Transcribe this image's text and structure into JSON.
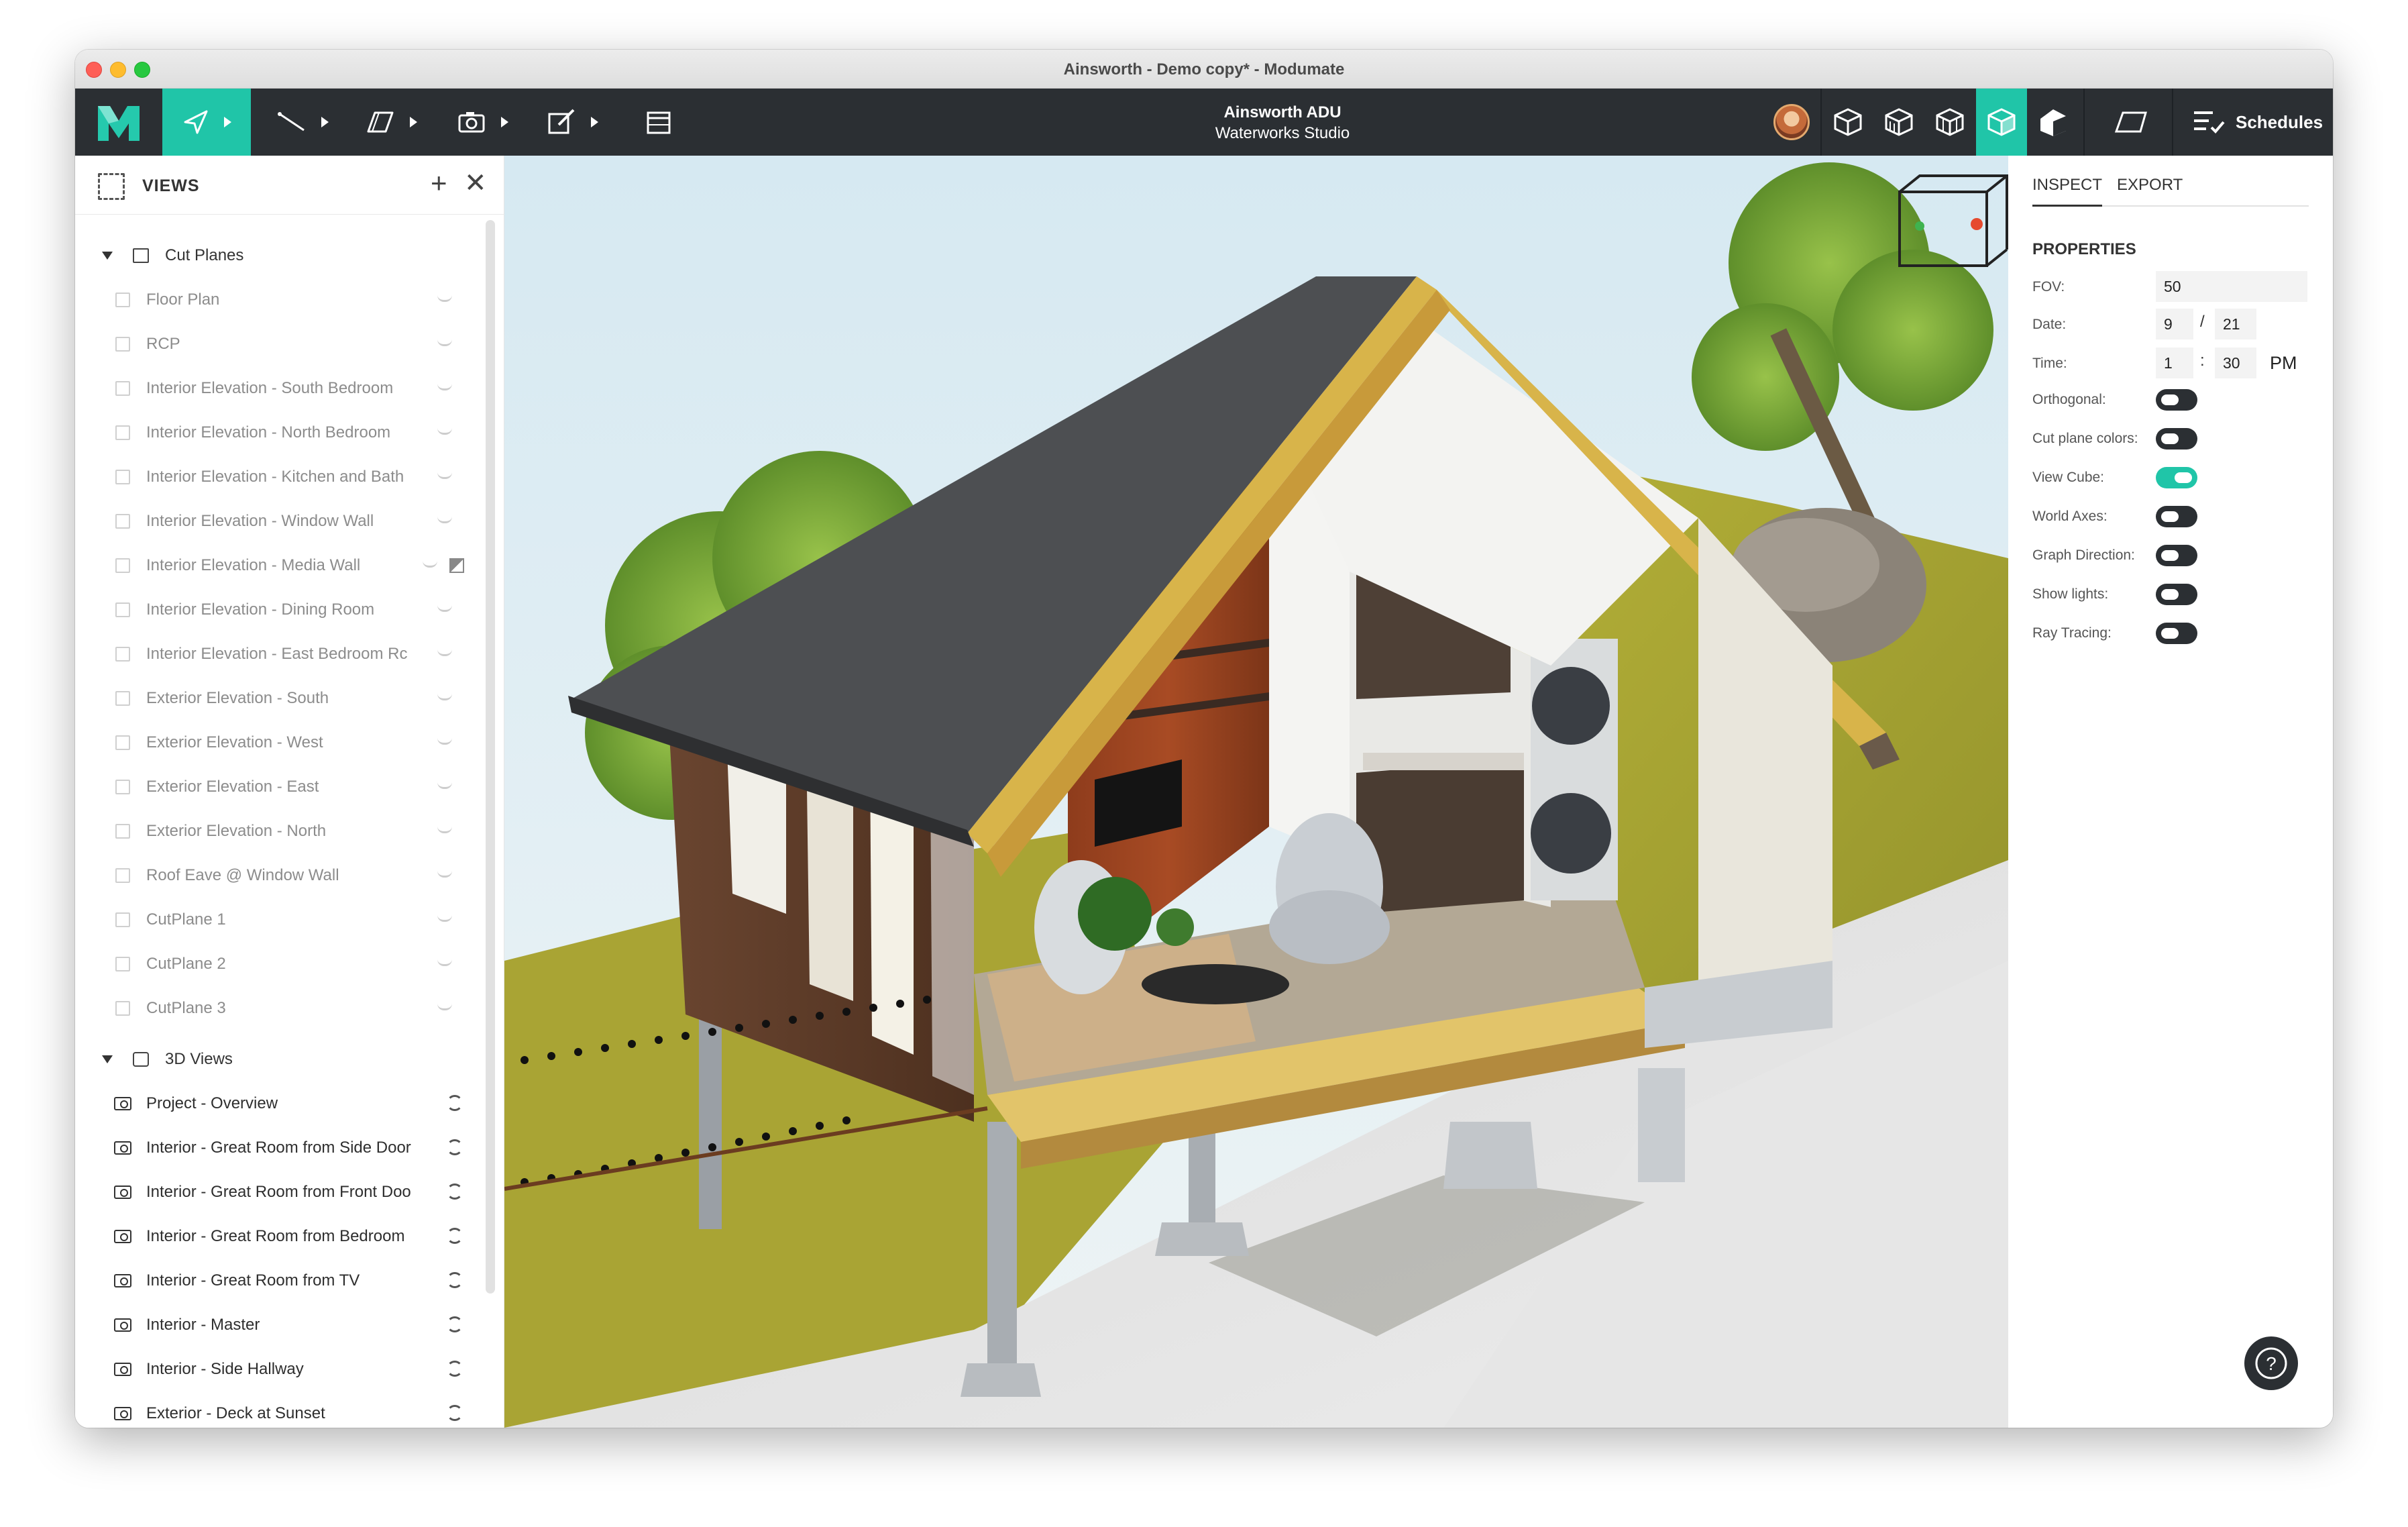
{
  "window": {
    "title": "Ainsworth - Demo copy* - Modumate"
  },
  "toolbar": {
    "project_name": "Ainsworth ADU",
    "studio_name": "Waterworks Studio",
    "schedules_label": "Schedules",
    "accent_color": "#20c5a8",
    "bar_color": "#2b2f33"
  },
  "views_panel": {
    "title": "VIEWS",
    "add_symbol": "+",
    "close_symbol": "✕",
    "cut_planes_group": "Cut Planes",
    "cut_planes": [
      "Floor Plan",
      "RCP",
      "Interior Elevation - South Bedroom",
      "Interior Elevation - North Bedroom",
      "Interior Elevation - Kitchen and Bath",
      "Interior Elevation - Window Wall",
      "Interior Elevation - Media Wall",
      "Interior Elevation - Dining Room",
      "Interior Elevation - East Bedroom Rc",
      "Exterior Elevation - South",
      "Exterior Elevation - West",
      "Exterior Elevation - East",
      "Exterior Elevation - North",
      "Roof Eave @ Window Wall",
      "CutPlane 1",
      "CutPlane 2",
      "CutPlane 3"
    ],
    "views_3d_group": "3D Views",
    "views_3d": [
      "Project - Overview",
      "Interior - Great Room from Side Door",
      "Interior - Great Room from Front Doo",
      "Interior - Great Room from Bedroom",
      "Interior - Great Room from TV",
      "Interior - Master",
      "Interior - Side Hallway",
      "Exterior - Deck at Sunset"
    ]
  },
  "inspector": {
    "tab_inspect": "INSPECT",
    "tab_export": "EXPORT",
    "section_title": "PROPERTIES",
    "fov_label": "FOV:",
    "fov_value": "50",
    "date_label": "Date:",
    "date_month": "9",
    "date_sep": "/",
    "date_day": "21",
    "time_label": "Time:",
    "time_hour": "1",
    "time_sep": ":",
    "time_minute": "30",
    "time_ampm": "PM",
    "toggles": [
      {
        "label": "Orthogonal:",
        "on": false
      },
      {
        "label": "Cut plane colors:",
        "on": false
      },
      {
        "label": "View Cube:",
        "on": true
      },
      {
        "label": "World Axes:",
        "on": false
      },
      {
        "label": "Graph Direction:",
        "on": false
      },
      {
        "label": "Show lights:",
        "on": false
      },
      {
        "label": "Ray Tracing:",
        "on": false
      }
    ]
  },
  "help": {
    "symbol": "?"
  }
}
